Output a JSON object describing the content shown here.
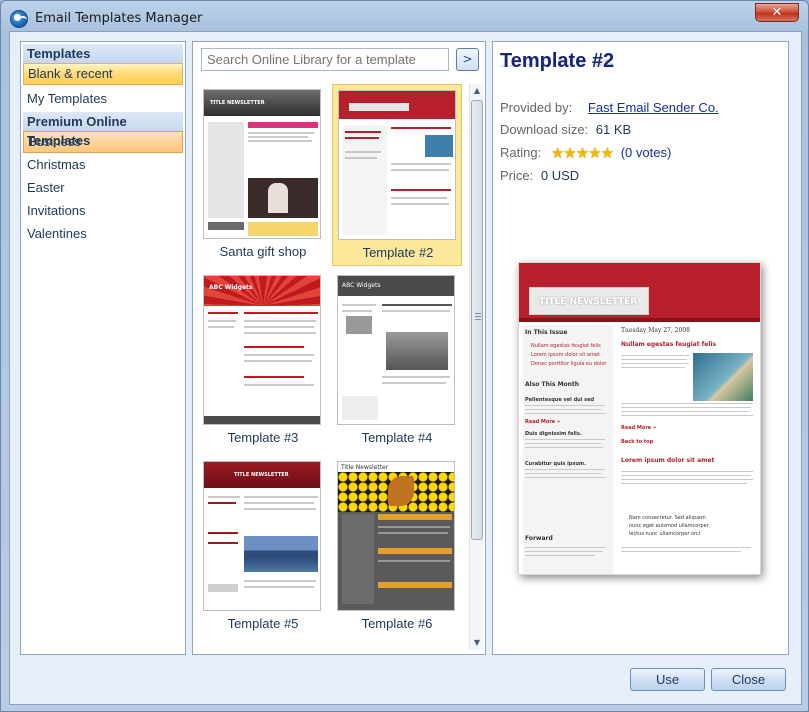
{
  "window": {
    "title": "Email Templates Manager",
    "close_glyph": "✕"
  },
  "categories": {
    "group_templates": "Templates",
    "blank_recent": "Blank & recent",
    "my_templates": "My Templates",
    "group_premium": "Premium Online Templates",
    "items": [
      "Business",
      "Christmas",
      "Easter",
      "Invitations",
      "Valentines"
    ]
  },
  "search": {
    "placeholder": "Search Online Library for a template",
    "button_glyph": ">"
  },
  "gallery": {
    "tiles": [
      {
        "label": "Santa gift shop"
      },
      {
        "label": "Template #2"
      },
      {
        "label": "Template #3"
      },
      {
        "label": "Template #4"
      },
      {
        "label": "Template #5"
      },
      {
        "label": "Template #6"
      }
    ],
    "thumb_text": {
      "t1_header": "TITLE NEWSLETTER",
      "t3_header": "ABC Widgets",
      "t4_header": "ABC Widgets",
      "t5_header": "TITLE NEWSLETTER",
      "t6_header": "Title Newsletter"
    }
  },
  "details": {
    "title": "Template #2",
    "provided_by_label": "Provided by:",
    "provided_by_value": "Fast Email Sender Co.",
    "download_size_label": "Download size:",
    "download_size_value": "61 KB",
    "rating_label": "Rating:",
    "rating_stars": "★★★★★",
    "rating_votes": "(0 votes)",
    "price_label": "Price:",
    "price_value": "0 USD"
  },
  "preview": {
    "banner": "TITLE NEWSLETTER",
    "in_this_issue": "In This Issue",
    "issue_items": [
      "Nullam egestas feugiat felis",
      "Lorem ipsum dolor sit amet",
      "Donec porttitor ligula eu dolor"
    ],
    "also_this_month": "Also This Month",
    "articles": [
      "Pellentesque vel dui sed",
      "Duis dignissim felis.",
      "Curabitur quis ipsum."
    ],
    "read_more": "Read More »",
    "forward": "Forward",
    "forward_text": "Know someone who might be interested in the email? Forward this email to a friend.",
    "date": "Tuesday May 27, 2008",
    "headline1": "Nullam egestas feugiat felis",
    "back_to_top": "Back to top",
    "headline2": "Lorem ipsum dolor sit amet",
    "bullets": [
      "Nam consectetur. Sed aliquam",
      "nunc eget euismod ullamcorper",
      "lectus nunc ullamcorper orci"
    ]
  },
  "buttons": {
    "use": "Use",
    "close": "Close"
  },
  "colors": {
    "accent": "#1e395b",
    "selection": "#ffd770",
    "preview_red": "#b7202a"
  }
}
